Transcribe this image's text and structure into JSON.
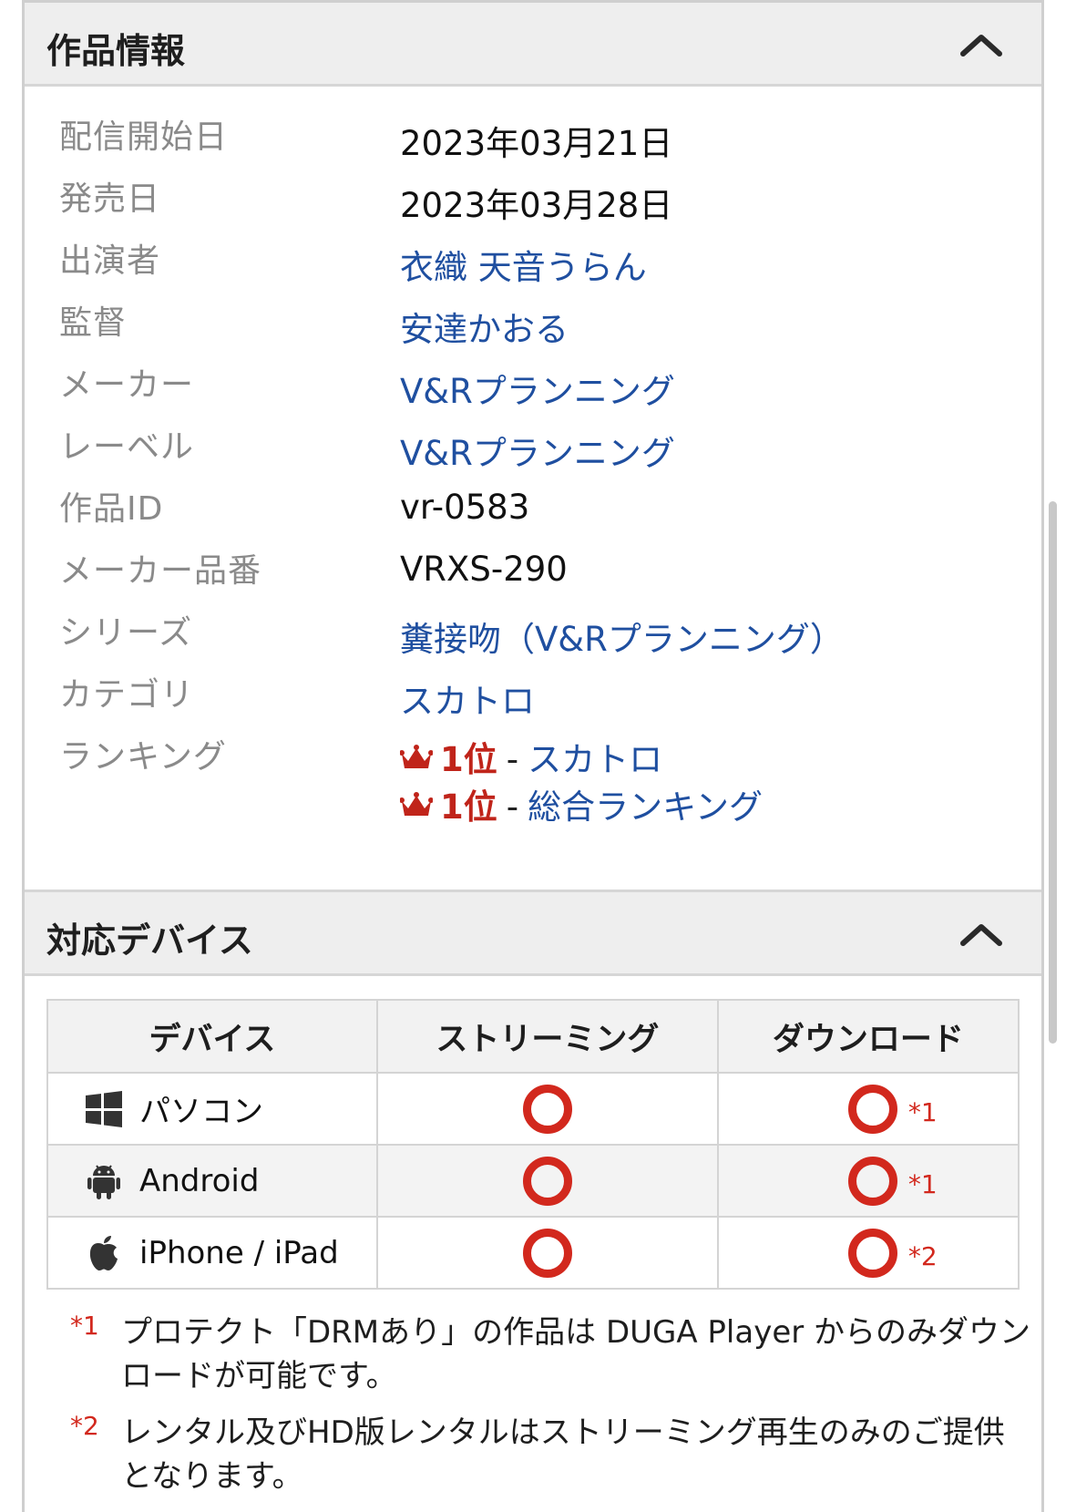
{
  "info_section": {
    "title": "作品情報",
    "collapse_icon": "chevron-up-icon",
    "rows": [
      {
        "label": "配信開始日",
        "value": "2023年03月21日",
        "is_link": false
      },
      {
        "label": "発売日",
        "value": "2023年03月28日",
        "is_link": false
      },
      {
        "label": "出演者",
        "value": "衣織  天音うらん",
        "is_link": true
      },
      {
        "label": "監督",
        "value": "安達かおる",
        "is_link": true
      },
      {
        "label": "メーカー",
        "value": "V&Rプランニング",
        "is_link": true
      },
      {
        "label": "レーベル",
        "value": "V&Rプランニング",
        "is_link": true
      },
      {
        "label": "作品ID",
        "value": "vr-0583",
        "is_link": false
      },
      {
        "label": "メーカー品番",
        "value": "VRXS-290",
        "is_link": false
      },
      {
        "label": "シリーズ",
        "value": "糞接吻（V&Rプランニング）",
        "is_link": true
      },
      {
        "label": "カテゴリ",
        "value": "スカトロ",
        "is_link": true
      }
    ],
    "ranking": {
      "label": "ランキング",
      "entries": [
        {
          "rank": "1位",
          "separator": "-",
          "category": "スカトロ"
        },
        {
          "rank": "1位",
          "separator": "-",
          "category": "総合ランキング"
        }
      ]
    }
  },
  "device_section": {
    "title": "対応デバイス",
    "collapse_icon": "chevron-up-icon",
    "columns": [
      "デバイス",
      "ストリーミング",
      "ダウンロード"
    ],
    "rows": [
      {
        "device": "パソコン",
        "icon": "windows-icon",
        "streaming": "supported",
        "download": "supported",
        "note": "*1"
      },
      {
        "device": "Android",
        "icon": "android-icon",
        "streaming": "supported",
        "download": "supported",
        "note": "*1"
      },
      {
        "device": "iPhone / iPad",
        "icon": "apple-icon",
        "streaming": "supported",
        "download": "supported",
        "note": "*2"
      }
    ],
    "footnotes": [
      {
        "mark": "*1",
        "text": "プロテクト「DRMあり」の作品は DUGA Player からのみダウンロードが可能です。"
      },
      {
        "mark": "*2",
        "text": "レンタル及びHD版レンタルはストリーミング再生のみのご提供となります。"
      }
    ]
  },
  "colors": {
    "link": "#1f4fa0",
    "accent_red": "#d2281d",
    "label_gray": "#8a8a8a",
    "header_bg": "#eeeeee"
  }
}
